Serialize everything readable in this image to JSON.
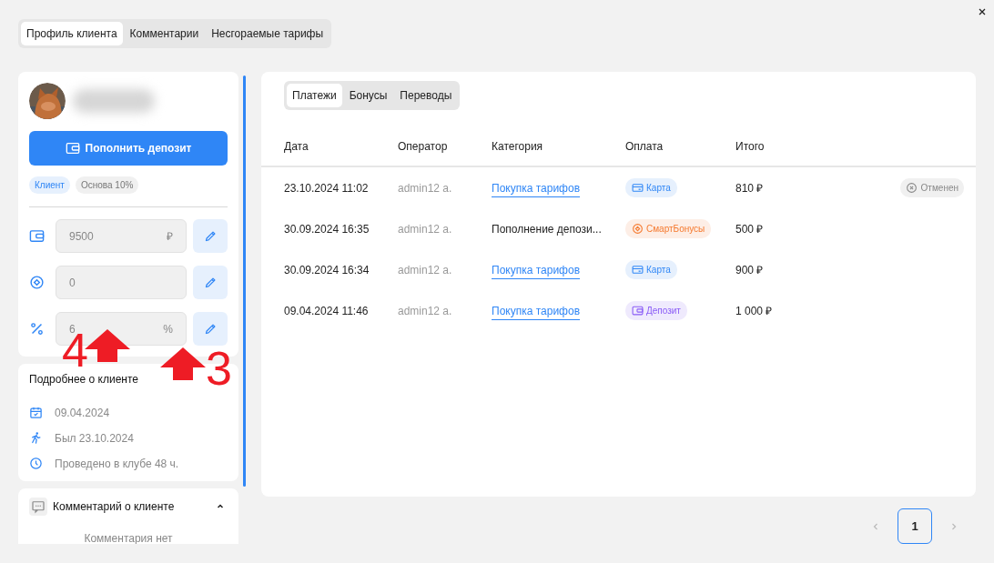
{
  "top_tabs": [
    {
      "label": "Профиль клиента",
      "selected": true
    },
    {
      "label": "Комментарии",
      "selected": false
    },
    {
      "label": "Несгораемые тарифы",
      "selected": false
    }
  ],
  "profile": {
    "deposit_button": "Пополнить депозит",
    "chips": [
      {
        "label": "Клиент",
        "kind": "role"
      },
      {
        "label": "Основа 10%",
        "kind": "plan"
      }
    ],
    "fields": [
      {
        "kind": "deposit",
        "value": "9500",
        "unit": "₽"
      },
      {
        "kind": "bonus",
        "value": "0"
      },
      {
        "kind": "discount",
        "value": "6",
        "unit": "%"
      }
    ]
  },
  "details": {
    "title": "Подробнее о клиенте",
    "items": [
      {
        "kind": "registered",
        "text": "09.04.2024"
      },
      {
        "kind": "visit",
        "text": "Был 23.10.2024"
      },
      {
        "kind": "time",
        "text": "Проведено в клубе 48 ч."
      }
    ]
  },
  "comment": {
    "title": "Комментарий о клиенте",
    "expanded": true,
    "empty_text": "Комментария нет"
  },
  "sub_tabs": [
    {
      "label": "Платежи",
      "selected": true
    },
    {
      "label": "Бонусы",
      "selected": false
    },
    {
      "label": "Переводы",
      "selected": false
    }
  ],
  "table": {
    "columns": [
      "Дата",
      "Оператор",
      "Категория",
      "Оплата",
      "Итого"
    ],
    "rows": [
      {
        "date": "23.10.2024 11:02",
        "operator": "admin12 a.",
        "category": {
          "text": "Покупка тарифов",
          "kind": "link"
        },
        "payment": {
          "label": "Карта",
          "kind": "card"
        },
        "total": "810 ₽",
        "status": "Отменен"
      },
      {
        "date": "30.09.2024 16:35",
        "operator": "admin12 a.",
        "category": {
          "text": "Пополнение депози...",
          "kind": "plain"
        },
        "payment": {
          "label": "СмартБонусы",
          "kind": "bonus"
        },
        "total": "500 ₽"
      },
      {
        "date": "30.09.2024 16:34",
        "operator": "admin12 a.",
        "category": {
          "text": "Покупка тарифов",
          "kind": "link"
        },
        "payment": {
          "label": "Карта",
          "kind": "card"
        },
        "total": "900 ₽"
      },
      {
        "date": "09.04.2024 11:46",
        "operator": "admin12 a.",
        "category": {
          "text": "Покупка тарифов",
          "kind": "link"
        },
        "payment": {
          "label": "Депозит",
          "kind": "deposit"
        },
        "total": "1 000 ₽"
      }
    ]
  },
  "pagination": {
    "pages": [
      {
        "label": "1",
        "selected": true
      }
    ]
  },
  "annotations": [
    {
      "label": "4"
    },
    {
      "label": "3"
    }
  ]
}
